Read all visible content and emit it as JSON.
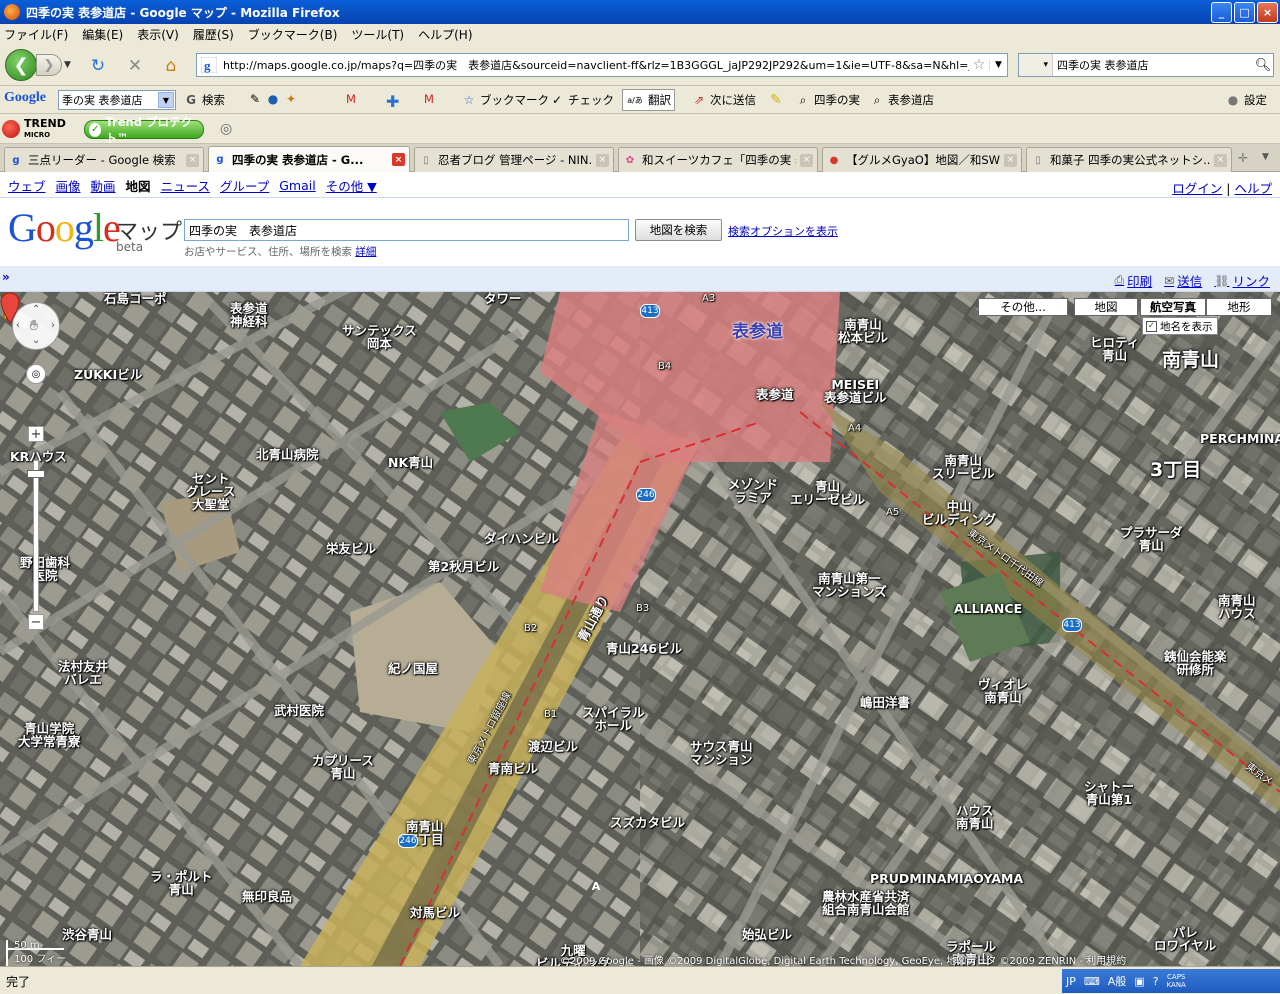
{
  "window": {
    "title": "四季の実 表参道店 - Google マップ - Mozilla Firefox",
    "controls": {
      "minimize": "_",
      "maximize": "□",
      "close": "×"
    }
  },
  "menu": [
    "ファイル(F)",
    "編集(E)",
    "表示(V)",
    "履歴(S)",
    "ブックマーク(B)",
    "ツール(T)",
    "ヘルプ(H)"
  ],
  "nav": {
    "url": "http://maps.google.co.jp/maps?q=四季の実　表参道店&sourceid=navclient-ff&rlz=1B3GGGL_jaJP292JP292&um=1&ie=UTF-8&sa=N&hl=ja&tab=wl",
    "search_value": "四季の実 表参道店"
  },
  "google_toolbar": {
    "logo": "Google",
    "search_value": "季の実 表参道店",
    "items": [
      "検索",
      "ブックマーク",
      "チェック",
      "翻訳",
      "次に送信",
      "四季の実",
      "表参道店",
      "設定"
    ],
    "translate_glyph": "a/あ"
  },
  "trend_toolbar": {
    "logo_line1": "TREND",
    "logo_line2": "MICRO",
    "pro_label": "Trend プロテクト™"
  },
  "tabs": [
    {
      "label": "三点リーダー - Google 検索",
      "active": false
    },
    {
      "label": "四季の実 表参道店 - G...",
      "active": true
    },
    {
      "label": "忍者ブログ 管理ページ - NIN...",
      "active": false
    },
    {
      "label": "和スイーツカフェ「四季の実 表...",
      "active": false
    },
    {
      "label": "【グルメGyaO】地図／和SWE...",
      "active": false
    },
    {
      "label": "和菓子 四季の実公式ネットシ...",
      "active": false
    }
  ],
  "gbar": {
    "links": [
      "ウェブ",
      "画像",
      "動画"
    ],
    "current": "地図",
    "links2": [
      "ニュース",
      "グループ",
      "Gmail"
    ],
    "more": "その他 ▼",
    "login": "ログイン",
    "help": "ヘルプ"
  },
  "maps": {
    "logo_maps": "マップ",
    "logo_beta": "beta",
    "query": "四季の実　表参道店",
    "search_button": "地図を検索",
    "search_options": "検索オプションを表示",
    "hint": "お店やサービス、住所、場所を検索",
    "hint_link": "詳細",
    "actions": {
      "print": "印刷",
      "send": "送信",
      "link": "リンク"
    },
    "expand": "»"
  },
  "map": {
    "types": {
      "more": "その他...",
      "map": "地図",
      "satellite": "航空写真",
      "terrain": "地形"
    },
    "show_labels": "地名を表示",
    "scale_m": "50 m",
    "scale_ft": "100 フィート",
    "copyright": "©2009 Google - 画像 ©2009 DigitalGlobe, Digital Earth Technology, GeoEye, 地図データ ©2009 ZENRIN - 利用規約",
    "marker": "A",
    "labels": [
      {
        "t": "石島コーポ"
      },
      {
        "t": "表参道\n神経科"
      },
      {
        "t": "サンテックス\n岡本"
      },
      {
        "t": "ZUKKIビル"
      },
      {
        "t": "北青山病院"
      },
      {
        "t": "NK青山"
      },
      {
        "t": "KRハウス"
      },
      {
        "t": "セント\nグレース\n大聖堂"
      },
      {
        "t": "栄友ビル"
      },
      {
        "t": "第2秋月ビル"
      },
      {
        "t": "ダイハンビル"
      },
      {
        "t": "野田歯科\n医院"
      },
      {
        "t": "紀ノ国屋"
      },
      {
        "t": "青山246ビル"
      },
      {
        "t": "法村友井\nバレエ"
      },
      {
        "t": "武村医院"
      },
      {
        "t": "青山学院\n大学常青寮"
      },
      {
        "t": "カプリース\n青山"
      },
      {
        "t": "渡辺ビル"
      },
      {
        "t": "青南ビル"
      },
      {
        "t": "スパイラル\nホール"
      },
      {
        "t": "サウス青山\nマンション"
      },
      {
        "t": "南青山\n五丁目"
      },
      {
        "t": "スズカタビル"
      },
      {
        "t": "ラ・ポルト\n青山"
      },
      {
        "t": "無印良品"
      },
      {
        "t": "対馬ビル"
      },
      {
        "t": "渋谷青山"
      },
      {
        "t": "九曜\nビルディング"
      },
      {
        "t": "始弘ビル"
      },
      {
        "t": "表参道"
      },
      {
        "t": "南青山\n松本ビル"
      },
      {
        "t": "MEISEI\n表参道ビル"
      },
      {
        "t": "メゾンド\nラミア"
      },
      {
        "t": "青山\nエリーゼビル"
      },
      {
        "t": "南青山\nスリービル"
      },
      {
        "t": "中山\nビルディング"
      },
      {
        "t": "ヒロティ\n青山"
      },
      {
        "t": "南青山"
      },
      {
        "t": "PERCHMINA"
      },
      {
        "t": "3丁目"
      },
      {
        "t": "プラサーダ\n青山"
      },
      {
        "t": "南青山第一\nマンションズ"
      },
      {
        "t": "ALLIANCE"
      },
      {
        "t": "南青山\nハウス"
      },
      {
        "t": "銕仙会能楽\n研修所"
      },
      {
        "t": "ヴィオレ\n南青山"
      },
      {
        "t": "嶋田洋書"
      },
      {
        "t": "シャトー\n青山第1"
      },
      {
        "t": "ハウス\n南青山"
      },
      {
        "t": "PRUDMINAMIAOYAMA"
      },
      {
        "t": "農林水産省共済\n組合南青山会館"
      },
      {
        "t": "ラポール\n南青山"
      },
      {
        "t": "パレ\nロワイヤル"
      },
      {
        "t": "青山通り"
      },
      {
        "t": "東京メトロ銀座線"
      },
      {
        "t": "東京メトロ千代田線"
      },
      {
        "t": "東京メ"
      },
      {
        "t": "表参道"
      },
      {
        "t": "タワー"
      }
    ],
    "road_shields": [
      "413",
      "246",
      "246",
      "413"
    ],
    "exits": [
      "A3",
      "B4",
      "A4",
      "A5",
      "B3",
      "B2",
      "B1"
    ]
  },
  "status": {
    "text": "完了",
    "ime": [
      "JP",
      "A般",
      "CAPS",
      "KANA"
    ]
  }
}
